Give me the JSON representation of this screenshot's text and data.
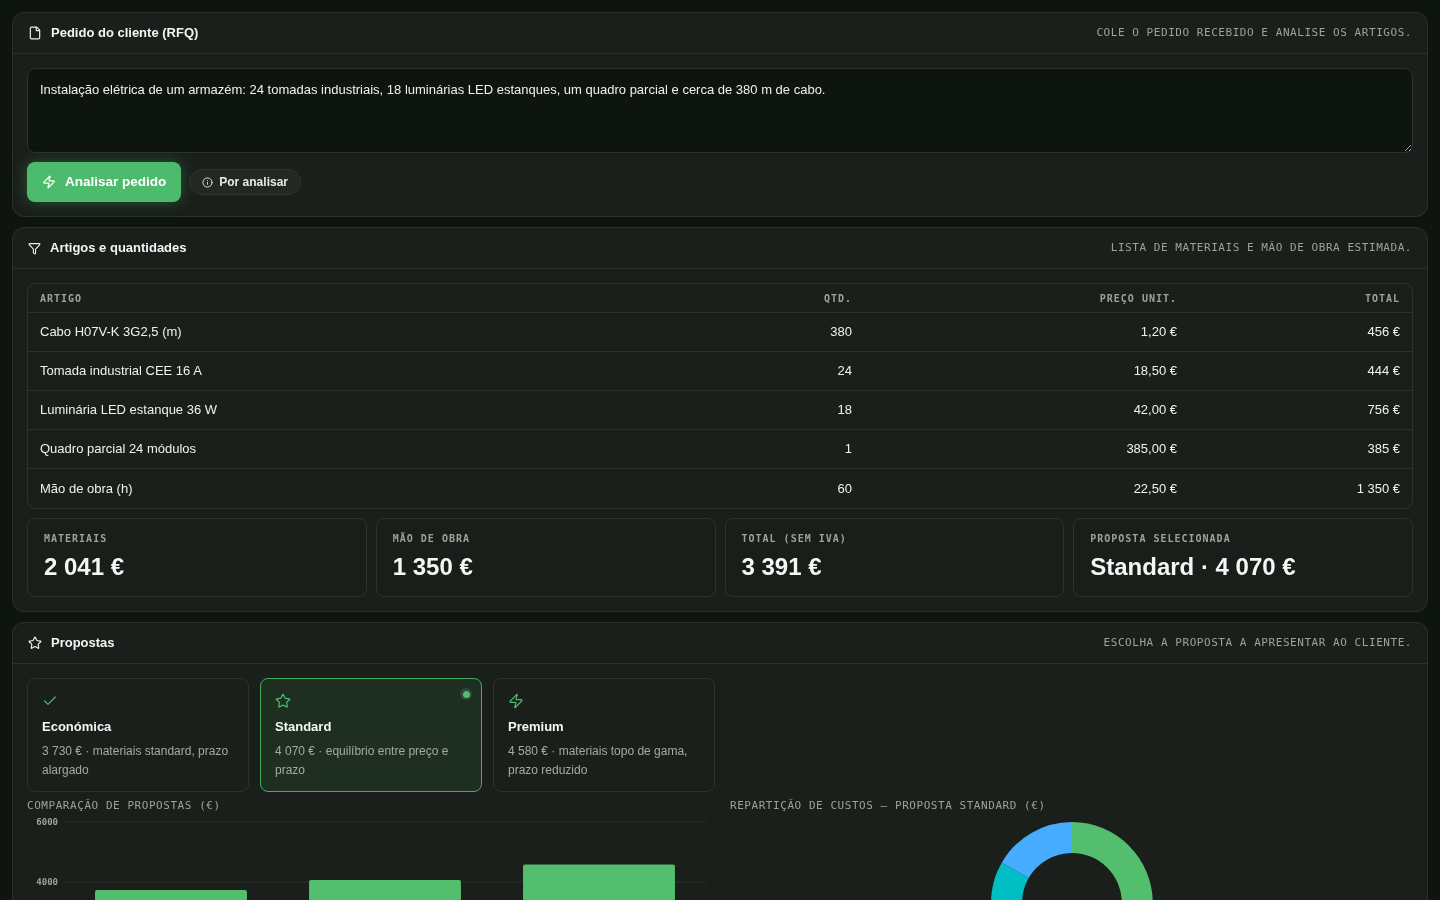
{
  "request": {
    "title": "Pedido do cliente (RFQ)",
    "caption": "COLE O PEDIDO RECEBIDO E ANALISE OS ARTIGOS.",
    "text": "Instalação elétrica de um armazém: 24 tomadas industriais, 18 luminárias LED estanques, um quadro parcial e cerca de 380 m de cabo.",
    "analyze_button": "Analisar pedido",
    "status": "Por analisar"
  },
  "items": {
    "title": "Artigos e quantidades",
    "caption": "LISTA DE MATERIAIS E MÃO DE OBRA ESTIMADA.",
    "table": {
      "columns": [
        "ARTIGO",
        "QTD.",
        "PREÇO UNIT.",
        "TOTAL"
      ],
      "rows": [
        [
          "Cabo H07V-K 3G2,5 (m)",
          "380",
          "1,20 €",
          "456 €"
        ],
        [
          "Tomada industrial CEE 16 A",
          "24",
          "18,50 €",
          "444 €"
        ],
        [
          "Luminária LED estanque 36 W",
          "18",
          "42,00 €",
          "756 €"
        ],
        [
          "Quadro parcial 24 módulos",
          "1",
          "385,00 €",
          "385 €"
        ],
        [
          "Mão de obra (h)",
          "60",
          "22,50 €",
          "1 350 €"
        ]
      ]
    },
    "summary": [
      {
        "label": "MATERIAIS",
        "value": "2 041 €"
      },
      {
        "label": "MÃO DE OBRA",
        "value": "1 350 €"
      },
      {
        "label": "TOTAL (SEM IVA)",
        "value": "3 391 €"
      },
      {
        "label": "PROPOSTA SELECIONADA",
        "value": "Standard · 4 070 €"
      }
    ]
  },
  "proposals": {
    "title": "Propostas",
    "caption": "ESCOLHA A PROPOSTA A APRESENTAR AO CLIENTE.",
    "options": [
      {
        "name": "Económica",
        "description": "3 730 € · materiais standard, prazo alargado",
        "selected": false
      },
      {
        "name": "Standard",
        "description": "4 070 € · equilíbrio entre preço e prazo",
        "selected": true
      },
      {
        "name": "Premium",
        "description": "4 580 € · materiais topo de gama, prazo reduzido",
        "selected": false
      }
    ],
    "charts": [
      {
        "chart_data": {
          "type": "bar",
          "title": "COMPARAÇÃO DE PROPOSTAS (€)",
          "series": [
            {
              "color": "#52be6e",
              "values": [
                3730,
                4070,
                4580
              ]
            }
          ],
          "ylim": [
            0,
            6000
          ],
          "yticks": [
            4000,
            6000
          ]
        }
      },
      {
        "chart_data": {
          "type": "donut",
          "title": "REPARTIÇÃO DE CUSTOS — PROPOSTA STANDARD (€)",
          "values": [
            50.1,
            33.2,
            16.7
          ],
          "colors": [
            "#52be6e",
            "#00bfc4",
            "#45acff"
          ]
        }
      }
    ]
  }
}
